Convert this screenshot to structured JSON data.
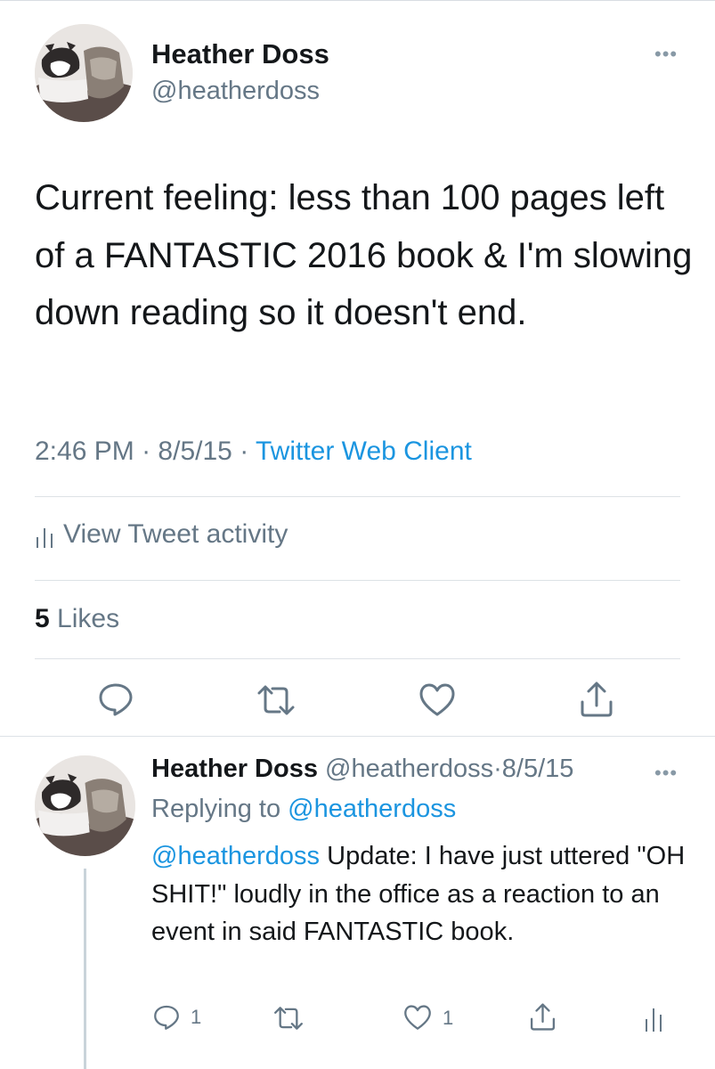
{
  "main_tweet": {
    "author_name": "Heather Doss",
    "author_handle": "@heatherdoss",
    "more_icon": "more-icon",
    "text": "Current feeling: less than 100 pages left of a FANTASTIC 2016 book & I'm slowing down reading so it doesn't end.",
    "time": "2:46 PM",
    "separator": "·",
    "date": "8/5/15",
    "client": "Twitter Web Client",
    "activity_label": "View Tweet activity",
    "likes_count": "5",
    "likes_label": "Likes",
    "actions": [
      "reply-icon",
      "retweet-icon",
      "like-icon",
      "share-icon"
    ]
  },
  "reply_tweet": {
    "author_name": "Heather Doss",
    "author_handle": "@heatherdoss",
    "separator": "·",
    "date": "8/5/15",
    "replying_prefix": "Replying to",
    "replying_to": "@heatherdoss",
    "mention": "@heatherdoss",
    "text": "Update: I have just uttered \"OH SHIT!\" loudly in the office as a  reaction to an event in said FANTASTIC book.",
    "reply_count": "1",
    "like_count": "1",
    "actions": [
      "reply-icon",
      "retweet-icon",
      "like-icon",
      "share-icon",
      "analytics-icon"
    ]
  },
  "colors": {
    "text": "#14171a",
    "secondary": "#657786",
    "link": "#1b95e0",
    "divider": "#dde2e6"
  }
}
